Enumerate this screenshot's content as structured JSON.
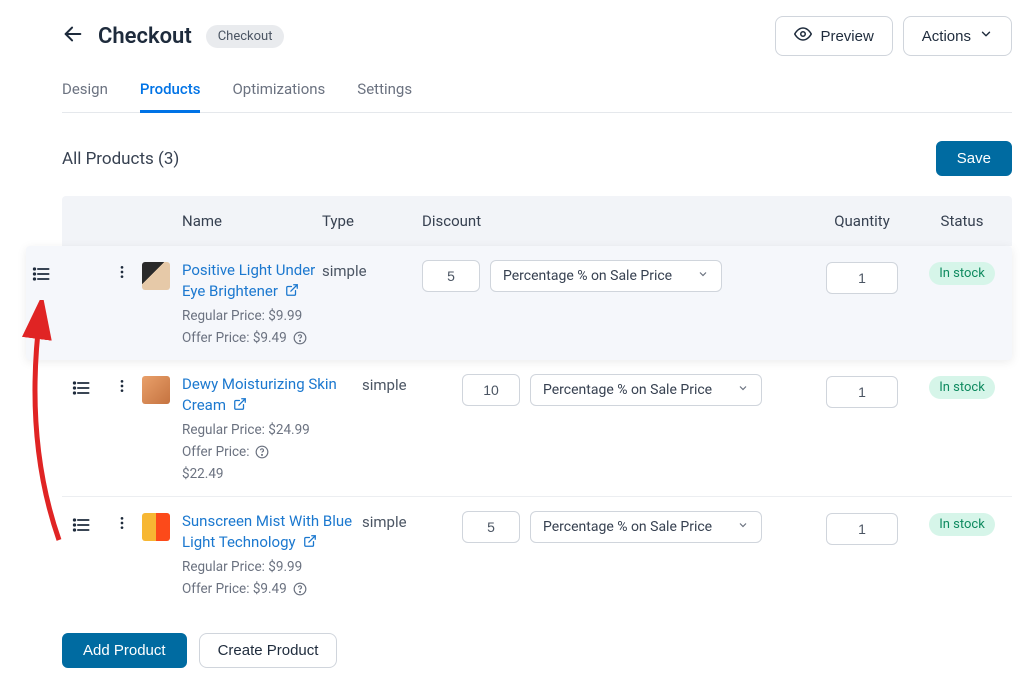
{
  "header": {
    "title": "Checkout",
    "badge": "Checkout",
    "preview_label": "Preview",
    "actions_label": "Actions"
  },
  "tabs": [
    "Design",
    "Products",
    "Optimizations",
    "Settings"
  ],
  "active_tab_index": 1,
  "section": {
    "title_prefix": "All Products",
    "count": "(3)",
    "save_label": "Save"
  },
  "columns": {
    "name": "Name",
    "type": "Type",
    "discount": "Discount",
    "quantity": "Quantity",
    "status": "Status"
  },
  "discount_option": "Percentage % on Sale Price",
  "products": [
    {
      "name": "Positive Light Under Eye Brightener",
      "type": "simple",
      "discount": "5",
      "quantity": "1",
      "status": "In stock",
      "regular_price": "Regular Price: $9.99",
      "offer_price": "Offer Price: $9.49"
    },
    {
      "name": "Dewy Moisturizing Skin Cream",
      "type": "simple",
      "discount": "10",
      "quantity": "1",
      "status": "In stock",
      "regular_price": "Regular Price: $24.99",
      "offer_price_label": "Offer Price:",
      "offer_price_value": "$22.49"
    },
    {
      "name": "Sunscreen Mist With Blue Light Technology",
      "type": "simple",
      "discount": "5",
      "quantity": "1",
      "status": "In stock",
      "regular_price": "Regular Price: $9.99",
      "offer_price": "Offer Price: $9.49"
    }
  ],
  "footer": {
    "add_product": "Add Product",
    "create_product": "Create Product"
  }
}
